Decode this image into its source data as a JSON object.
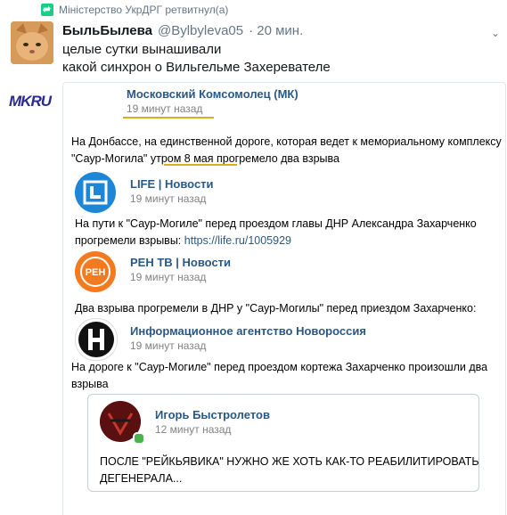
{
  "retweet": {
    "label": "Міністерство УкрДРГ ретвитнул(а)"
  },
  "tweet": {
    "name": "БыльБылева",
    "handle": "@Bylbyleva05",
    "time": "· 20 мин.",
    "text_line1": "целые сутки вынашивали",
    "text_line2": "какой синхрон о Вильгельме Захеревателе"
  },
  "posts": [
    {
      "logo": "MKRU",
      "name": "Московский Комсомолец (МК)",
      "time": "19 минут назад",
      "text1": "На Донбассе, на единственной дороге, которая ведет к мемориальному комплексу",
      "text2": "\"Саур-Могила\" утром 8 мая прогремело два взрыва"
    },
    {
      "logo": "life-logo",
      "name": "LIFE | Новости",
      "time": "19 минут назад",
      "text1": "На пути к \"Саур-Могиле\" перед проездом главы ДНР Александра Захарченко",
      "text2a": "прогремели взрывы: ",
      "link": "https://life.ru/1005929"
    },
    {
      "logo": "ren-logo",
      "logo_text": "РЕН",
      "name": "РЕН ТВ | Новости",
      "time": "19 минут назад",
      "text1": "Два взрыва прогремели в ДНР у \"Саур-Могилы\" перед приездом Захарченко:"
    },
    {
      "logo": "novorossia-logo",
      "name": "Информационное агентство Новороссия",
      "time": "19 минут назад",
      "text1": "На дороге к \"Саур-Могиле\" перед проездом кортежа Захарченко произошли два",
      "text2": "взрыва"
    },
    {
      "logo": "avatar",
      "name": "Игорь Быстролетов",
      "time": "12 минут назад",
      "text1": "ПОСЛЕ \"РЕЙКЬЯВИКА\" НУЖНО ЖЕ ХОТЬ КАК-ТО РЕАБИЛИТИРОВАТЬ",
      "text2": "ДЕГЕНЕРАЛА..."
    }
  ],
  "colors": {
    "link": "#2a5885",
    "underline": "#d4b01a",
    "retweet": "#19cf86",
    "online": "#4bb34b"
  }
}
